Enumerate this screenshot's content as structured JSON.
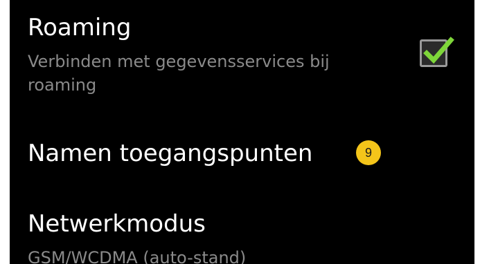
{
  "settings": {
    "roaming": {
      "title": "Roaming",
      "summary": "Verbinden met gegevensservices bij roaming",
      "checked": true
    },
    "apn": {
      "title": "Namen toegangspunten",
      "badge": "9"
    },
    "network_mode": {
      "title": "Netwerkmodus",
      "summary": "GSM/WCDMA (auto-stand)"
    }
  },
  "colors": {
    "background": "#000000",
    "title_text": "#ffffff",
    "summary_text": "#8a8a8a",
    "check_accent": "#7ed63a",
    "badge": "#f4c51a"
  },
  "icons": {
    "roaming_checkbox": "check-icon"
  }
}
